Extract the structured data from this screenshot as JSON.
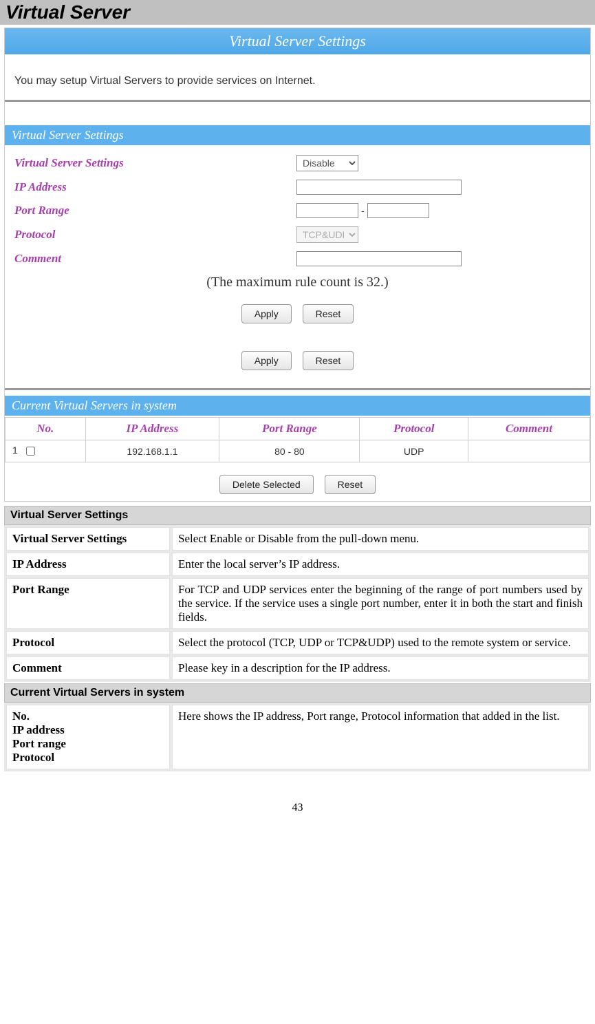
{
  "heading": "Virtual Server",
  "screenshot": {
    "title_bar": "Virtual Server Settings",
    "intro": "You may setup Virtual Servers to provide services on Internet.",
    "section_settings": "Virtual Server Settings",
    "form": {
      "virtual_server_settings_label": "Virtual Server Settings",
      "virtual_server_settings_value": "Disable",
      "ip_address_label": "IP Address",
      "ip_address_value": "",
      "port_range_label": "Port Range",
      "port_range_start": "",
      "port_range_sep": "-",
      "port_range_end": "",
      "protocol_label": "Protocol",
      "protocol_value": "TCP&UDP",
      "comment_label": "Comment",
      "comment_value": ""
    },
    "note": "(The maximum rule count is 32.)",
    "buttons": {
      "apply": "Apply",
      "reset": "Reset",
      "delete_selected": "Delete Selected"
    },
    "section_current": "Current Virtual Servers in system",
    "table": {
      "headers": {
        "no": "No.",
        "ip": "IP Address",
        "port_range": "Port Range",
        "protocol": "Protocol",
        "comment": "Comment"
      },
      "rows": [
        {
          "no": "1",
          "ip": "192.168.1.1",
          "port_range": "80 - 80",
          "protocol": "UDP",
          "comment": ""
        }
      ]
    }
  },
  "doc": {
    "section1_title": "Virtual Server Settings",
    "rows1": [
      {
        "key": "Virtual Server Settings",
        "val": "Select Enable or Disable from the pull-down menu."
      },
      {
        "key": "IP Address",
        "val": "Enter the local server’s IP address."
      },
      {
        "key": "Port Range",
        "val": "For TCP and UDP services enter the beginning of the range of port numbers used by the service. If the service uses a single port number, enter it in both the start and finish fields."
      },
      {
        "key": "Protocol",
        "val": "Select the protocol (TCP, UDP or TCP&UDP) used to the remote system or service."
      },
      {
        "key": "Comment",
        "val": "Please key in a description for the IP address."
      }
    ],
    "section2_title": "Current Virtual Servers in system",
    "row2_key": "No.\nIP address\nPort range\nProtocol",
    "row2_val": "Here shows the IP address, Port range, Protocol information that added in the list."
  },
  "page_number": "43"
}
